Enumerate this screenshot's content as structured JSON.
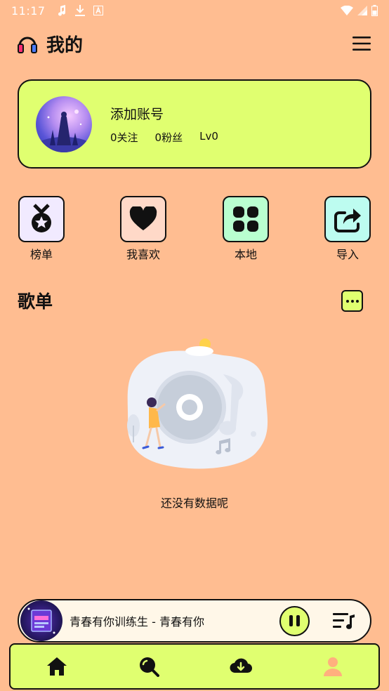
{
  "status_bar": {
    "time": "11:17",
    "left_icons": [
      "music-note-icon",
      "download-icon",
      "a-box-icon"
    ],
    "right_icons": [
      "wifi-icon",
      "signal-icon",
      "battery-icon"
    ]
  },
  "header": {
    "title": "我的",
    "icon": "headphones-icon",
    "menu_icon": "hamburger-menu-icon"
  },
  "account": {
    "name": "添加账号",
    "following": "0关注",
    "followers": "0粉丝",
    "level": "Lv0"
  },
  "quick_actions": [
    {
      "label": "榜单",
      "icon": "medal-icon",
      "color": "#f1eaff"
    },
    {
      "label": "我喜欢",
      "icon": "heart-icon",
      "color": "#ffd9c8"
    },
    {
      "label": "本地",
      "icon": "grid-icon",
      "color": "#b9ffd0"
    },
    {
      "label": "导入",
      "icon": "share-icon",
      "color": "#bdfcf0"
    }
  ],
  "playlist_section": {
    "title": "歌单",
    "more_icon": "more-dots-icon",
    "empty_text": "还没有数据呢"
  },
  "player": {
    "song": "青春有你训练生 - 青春有你",
    "state": "playing",
    "pause_icon": "pause-icon",
    "playlist_icon": "playlist-icon"
  },
  "tabs": [
    {
      "name": "home",
      "icon": "home-icon",
      "active": false
    },
    {
      "name": "search",
      "icon": "search-icon",
      "active": false
    },
    {
      "name": "download",
      "icon": "cloud-download-icon",
      "active": false
    },
    {
      "name": "mine",
      "icon": "user-icon",
      "active": true
    }
  ],
  "colors": {
    "background": "#ffbd91",
    "accent": "#e0ff70",
    "active_tab": "#ffb07e"
  }
}
